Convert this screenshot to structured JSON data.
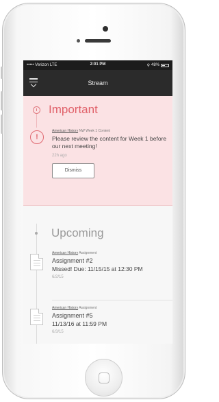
{
  "status_bar": {
    "carrier": "••••• Verizon  LTE",
    "time": "2:01 PM",
    "signal": "⚲",
    "battery": "48%"
  },
  "nav": {
    "title": "Stream"
  },
  "important": {
    "heading": "Important",
    "notice": {
      "course": "American History",
      "context": "NW Week 1 Content",
      "message": "Please review the content for Week 1 before our next meeting!",
      "ago": "22h ago",
      "dismiss_label": "Dismiss"
    }
  },
  "upcoming": {
    "heading": "Upcoming",
    "items": [
      {
        "course": "American History",
        "kind": "Assignment",
        "title": "Assignment #2",
        "detail": "Missed! Due: 11/15/15 at 12:30 PM",
        "date": "6/2/15"
      },
      {
        "course": "American History",
        "kind": "Assignment",
        "title": "Assignment #5",
        "detail": "11/13/16 at 11:59 PM",
        "date": "6/3/15"
      }
    ]
  },
  "colors": {
    "important_bg": "#fbe2e4",
    "important_accent": "#e05f68",
    "navbar_bg": "#2b2b2b"
  }
}
